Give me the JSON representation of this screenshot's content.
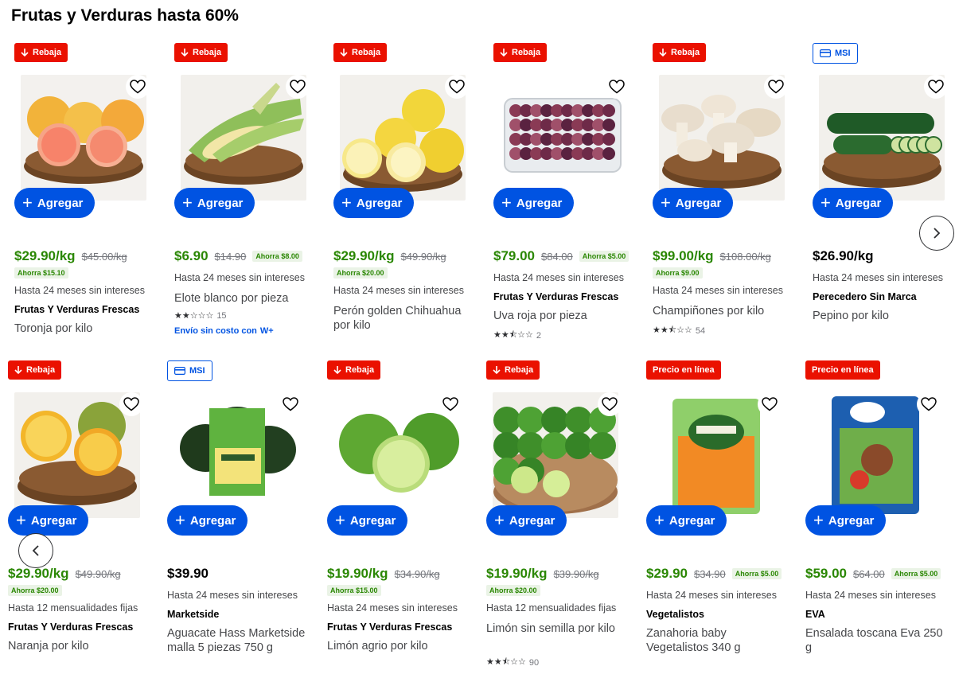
{
  "title": "Frutas y Verduras hasta 60%",
  "ui": {
    "add_label": "Agregar",
    "badge_rebaja": "Rebaja",
    "badge_msi": "MSI",
    "badge_precio": "Precio en línea",
    "shipping_text": "Envío sin costo con",
    "wp_label": "W+"
  },
  "colors": {
    "brand_blue": "#0053e2",
    "price_green": "#2a8703",
    "badge_red": "#ea1100"
  },
  "products": [
    {
      "badge": "Rebaja",
      "image": "grapefruit-icon",
      "price": "$29.90/kg",
      "old_price": "$45.00/kg",
      "save": "Ahorra $15.10",
      "save_below": true,
      "installments": "Hasta 24 meses sin intereses",
      "brand": "Frutas Y Verduras Frescas",
      "name": "Toronja por kilo"
    },
    {
      "badge": "Rebaja",
      "image": "corn-icon",
      "price": "$6.90",
      "old_price": "$14.90",
      "save": "Ahorra $8.00",
      "save_below": false,
      "installments": "Hasta 24 meses sin intereses",
      "brand": "",
      "name": "Elote blanco por pieza",
      "rating": 2,
      "reviews": "15",
      "shipping": true
    },
    {
      "badge": "Rebaja",
      "image": "apple-icon",
      "price": "$29.90/kg",
      "old_price": "$49.90/kg",
      "save": "Ahorra $20.00",
      "save_below": true,
      "installments": "Hasta 24 meses sin intereses",
      "brand": "",
      "name": "Perón golden Chihuahua por kilo"
    },
    {
      "badge": "Rebaja",
      "image": "grapes-icon",
      "price": "$79.00",
      "old_price": "$84.00",
      "save": "Ahorra $5.00",
      "save_below": false,
      "installments": "Hasta 24 meses sin intereses",
      "brand": "Frutas Y Verduras Frescas",
      "name": "Uva roja por pieza",
      "rating": 2.5,
      "reviews": "2"
    },
    {
      "badge": "Rebaja",
      "image": "mushroom-icon",
      "price": "$99.00/kg",
      "old_price": "$108.00/kg",
      "save": "Ahorra $9.00",
      "save_below": true,
      "installments": "Hasta 24 meses sin intereses",
      "brand": "",
      "name": "Champiñones por kilo",
      "rating": 2.5,
      "reviews": "54"
    },
    {
      "badge": "MSI",
      "image": "cucumber-icon",
      "price": "$26.90/kg",
      "old_price": "",
      "save": "",
      "save_below": false,
      "installments": "Hasta 24 meses sin intereses",
      "brand": "Perecedero Sin Marca",
      "name": "Pepino por kilo"
    },
    {
      "badge": "Rebaja",
      "image": "orange-icon",
      "price": "$29.90/kg",
      "old_price": "$49.90/kg",
      "save": "Ahorra $20.00",
      "save_below": true,
      "installments": "Hasta 12 mensualidades fijas",
      "brand": "Frutas Y Verduras Frescas",
      "name": "Naranja por kilo"
    },
    {
      "badge": "MSI",
      "image": "avocado-icon",
      "price": "$39.90",
      "old_price": "",
      "save": "",
      "save_below": false,
      "installments": "Hasta 24 meses sin intereses",
      "brand": "Marketside",
      "name": "Aguacate Hass Marketside malla 5 piezas 750 g"
    },
    {
      "badge": "Rebaja",
      "image": "lime-icon",
      "price": "$19.90/kg",
      "old_price": "$34.90/kg",
      "save": "Ahorra $15.00",
      "save_below": true,
      "installments": "Hasta 24 meses sin intereses",
      "brand": "Frutas Y Verduras Frescas",
      "name": "Limón agrio por kilo"
    },
    {
      "badge": "Rebaja",
      "image": "seedless-lime-icon",
      "price": "$19.90/kg",
      "old_price": "$39.90/kg",
      "save": "Ahorra $20.00",
      "save_below": true,
      "installments": "Hasta 12 mensualidades fijas",
      "brand": "",
      "name": "Limón sin semilla por kilo",
      "rating": 2.5,
      "reviews": "90"
    },
    {
      "badge": "Precio en línea",
      "image": "carrot-bag-icon",
      "price": "$29.90",
      "old_price": "$34.90",
      "save": "Ahorra $5.00",
      "save_below": false,
      "installments": "Hasta 24 meses sin intereses",
      "brand": "Vegetalistos",
      "name": "Zanahoria baby Vegetalistos 340 g"
    },
    {
      "badge": "Precio en línea",
      "image": "salad-bag-icon",
      "price": "$59.00",
      "old_price": "$64.00",
      "save": "Ahorra $5.00",
      "save_below": false,
      "installments": "Hasta 24 meses sin intereses",
      "brand": "EVA",
      "name": "Ensalada toscana Eva 250 g"
    }
  ]
}
